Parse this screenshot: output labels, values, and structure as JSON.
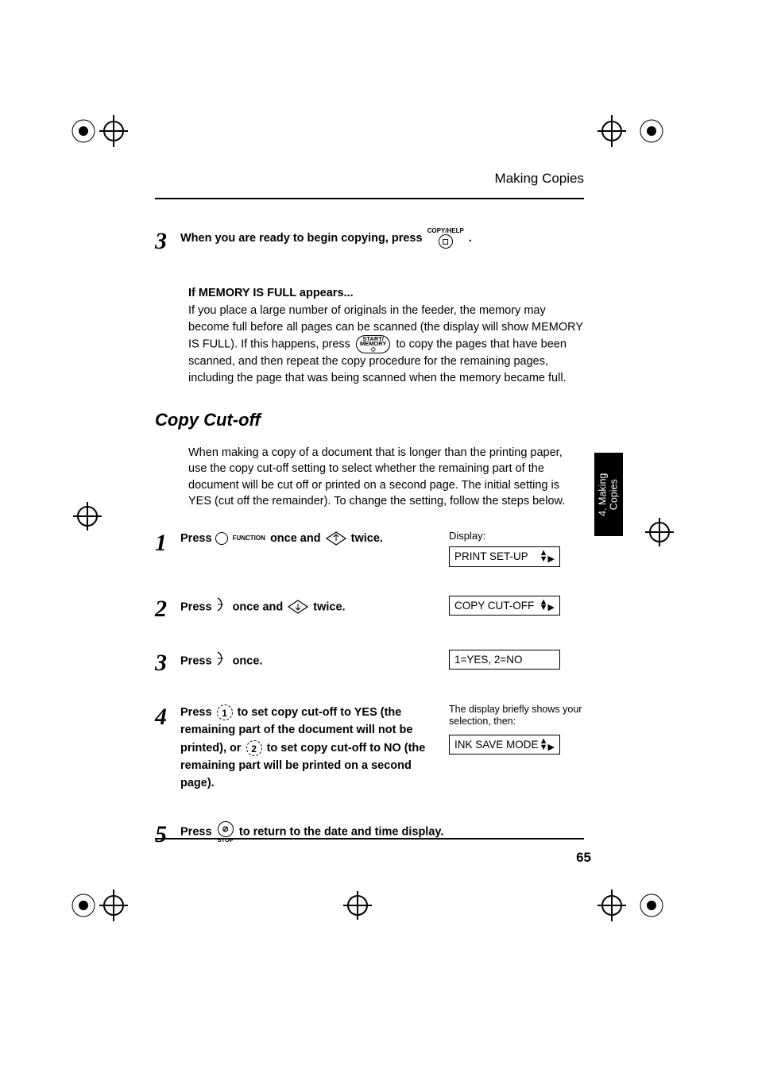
{
  "header": {
    "title": "Making Copies"
  },
  "topStep": {
    "num": "3",
    "text_before": "When you are ready to begin copying, press ",
    "icon_label": "COPY/HELP",
    "text_after": "."
  },
  "memory": {
    "title": "If MEMORY IS FULL appears...",
    "p1": "If you place a large number of originals in the feeder, the memory may become full before all pages can be scanned (the display will show MEMORY IS FULL). If this happens, press",
    "btn_l1": "START/",
    "btn_l2": "MEMORY",
    "p2": "to copy the pages that have been scanned, and then repeat the copy procedure for the remaining pages, including the page that was being scanned when the memory became full."
  },
  "section": {
    "heading": "Copy Cut-off",
    "intro": "When making a copy of a document that is longer than the printing paper, use the copy cut-off setting to select whether the remaining part of the document will be cut off or printed on a second page. The initial setting is YES (cut off the remainder). To change the setting, follow the steps below."
  },
  "steps": [
    {
      "num": "1",
      "parts": {
        "a": "Press ",
        "func": "FUNCTION",
        "b": " once and ",
        "c": " twice."
      },
      "displayLabel": "Display:",
      "displayText": "PRINT SET-UP"
    },
    {
      "num": "2",
      "parts": {
        "a": "Press ",
        "b": " once and ",
        "c": " twice."
      },
      "displayText": "COPY CUT-OFF"
    },
    {
      "num": "3",
      "parts": {
        "a": "Press ",
        "b": " once."
      },
      "displayText": "1=YES, 2=NO"
    },
    {
      "num": "4",
      "parts": {
        "a": "Press ",
        "b": " to set copy cut-off to YES (the remaining part of the document will not be printed), or ",
        "c": " to set copy cut-off to NO (the remaining part will be printed on a second page)."
      },
      "key1": "1",
      "key2": "2",
      "resultNote": "The display briefly shows your selection, then:",
      "displayText": "INK SAVE MODE"
    },
    {
      "num": "5",
      "parts": {
        "a": "Press ",
        "stop": "STOP",
        "b": " to return to the date and time display."
      }
    }
  ],
  "sideTab": {
    "line1": "4. Making",
    "line2": "Copies"
  },
  "pageNumber": "65"
}
